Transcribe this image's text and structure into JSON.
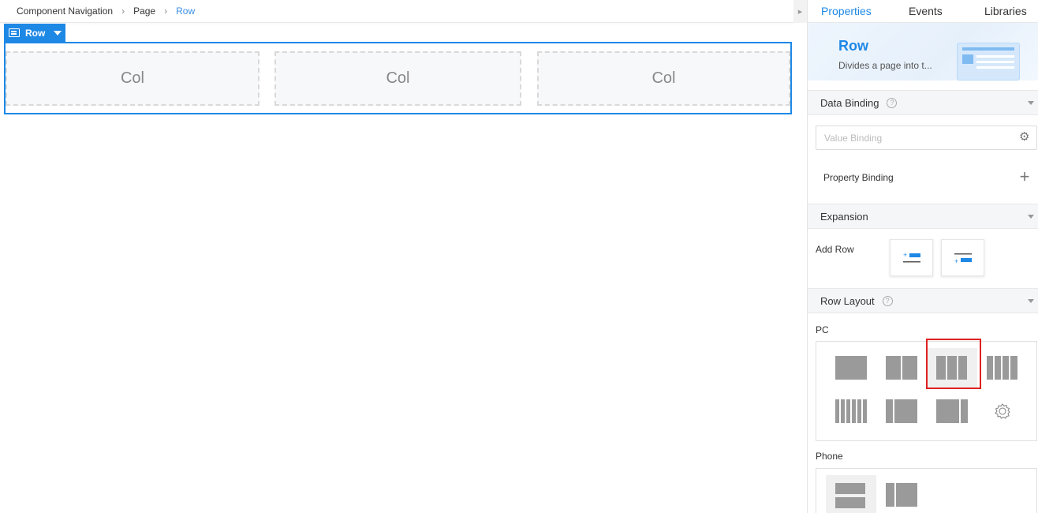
{
  "breadcrumb": [
    "Component Navigation",
    "Page",
    "Row"
  ],
  "row_tag": {
    "label": "Row"
  },
  "cols": [
    "Col",
    "Col",
    "Col"
  ],
  "panel": {
    "tabs": [
      "Properties",
      "Events",
      "Libraries"
    ],
    "active_tab": "Properties",
    "component": {
      "title": "Row",
      "description": "Divides a page into t..."
    },
    "data_binding": {
      "header": "Data Binding",
      "value_placeholder": "Value Binding",
      "property_binding_label": "Property Binding"
    },
    "expansion": {
      "header": "Expansion",
      "add_row_label": "Add Row"
    },
    "row_layout": {
      "header": "Row Layout",
      "pc_label": "PC",
      "phone_label": "Phone",
      "pc_selected_index": 2,
      "phone_selected_index": 0
    }
  },
  "colors": {
    "accent": "#1e88e5",
    "highlight": "#e02020",
    "layout_icon": "#9a9a9a"
  }
}
